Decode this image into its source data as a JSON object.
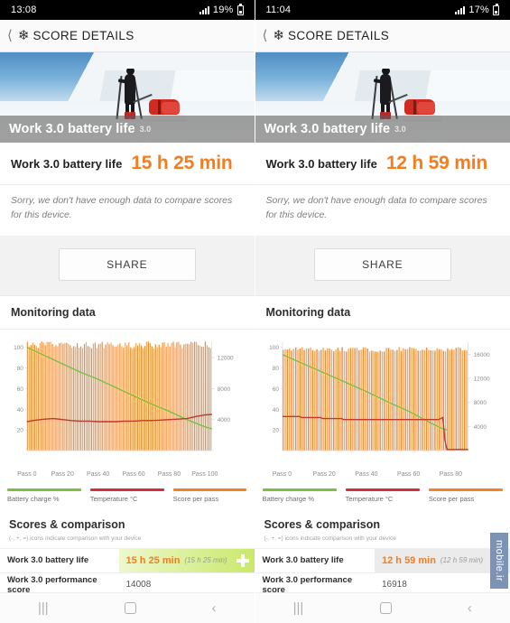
{
  "panels": [
    {
      "status": {
        "time": "13:08",
        "battery": "19%",
        "signal_icon": "signal-bars-icon",
        "battery_icon": "battery-icon"
      },
      "appbar": {
        "back_icon": "back-chevron-icon",
        "app_icon": "snowflake-icon",
        "title": "SCORE DETAILS"
      },
      "hero": {
        "caption": "Work 3.0 battery life",
        "badge": "3.0",
        "image": "skier-pulling-sled-in-snow"
      },
      "score": {
        "label": "Work 3.0 battery life",
        "value": "15 h 25 min"
      },
      "nodata": "Sorry, we don't have enough data to compare scores for this device.",
      "share_label": "SHARE",
      "monitoring_title": "Monitoring data",
      "legend": [
        {
          "label": "Battery charge %",
          "color": "#7ac143"
        },
        {
          "label": "Temperature °C",
          "color": "#d12f3b"
        },
        {
          "label": "Score per pass",
          "color": "#f58220"
        }
      ],
      "comparison": {
        "title": "Scores & comparison",
        "subtitle": "(-, +, =) icons indicate comparison with your device",
        "rows": [
          {
            "name": "Work 3.0 battery life",
            "value": "15 h 25 min",
            "reference": "(15 h 25 min)",
            "icon": "plus-icon",
            "highlight": "green"
          },
          {
            "name": "Work 3.0 performance score",
            "value": "14008",
            "reference": "",
            "icon": "",
            "highlight": "none"
          }
        ]
      },
      "chart_data": {
        "type": "line",
        "title": "Monitoring data",
        "xlabel": "",
        "ylabel": "Battery charge % / Temperature °C",
        "y2label": "Score per pass",
        "ylim": [
          0,
          105
        ],
        "y2lim": [
          0,
          14000
        ],
        "yticks": [
          20,
          40,
          60,
          80,
          100
        ],
        "y2ticks": [
          4000,
          8000,
          12000
        ],
        "xticks": [
          "Pass 0",
          "Pass 20",
          "Pass 40",
          "Pass 60",
          "Pass 80",
          "Pass 100"
        ],
        "xlim": [
          0,
          104
        ],
        "grid": false,
        "legend_position": "below",
        "series": [
          {
            "name": "Battery charge %",
            "color": "#7ac143",
            "type": "line",
            "x": [
              0,
              10,
              20,
              30,
              40,
              50,
              60,
              70,
              80,
              90,
              100,
              104
            ],
            "values": [
              100,
              92,
              84,
              76,
              69,
              61,
              53,
              45,
              38,
              30,
              23,
              21
            ]
          },
          {
            "name": "Temperature °C",
            "color": "#c0392b",
            "type": "line",
            "x": [
              0,
              5,
              10,
              15,
              20,
              25,
              30,
              35,
              40,
              45,
              50,
              55,
              60,
              65,
              70,
              75,
              80,
              85,
              90,
              95,
              100,
              104
            ],
            "values": [
              28,
              29.5,
              30.5,
              31,
              30,
              29,
              28.5,
              28.5,
              28,
              28,
              28,
              28.5,
              28.5,
              29,
              29,
              29.5,
              30,
              30.5,
              31,
              33,
              34.5,
              35
            ]
          },
          {
            "name": "Score per pass",
            "color": "#f58220",
            "type": "bar",
            "bar_count": 104,
            "value_range": [
              13200,
              14100
            ],
            "mean": 13700
          }
        ]
      }
    },
    {
      "status": {
        "time": "11:04",
        "battery": "17%",
        "signal_icon": "signal-bars-icon",
        "battery_icon": "battery-icon"
      },
      "appbar": {
        "back_icon": "back-chevron-icon",
        "app_icon": "snowflake-icon",
        "title": "SCORE DETAILS"
      },
      "hero": {
        "caption": "Work 3.0 battery life",
        "badge": "3.0",
        "image": "skier-pulling-sled-in-snow"
      },
      "score": {
        "label": "Work 3.0 battery life",
        "value": "12 h 59 min"
      },
      "nodata": "Sorry, we don't have enough data to compare scores for this device.",
      "share_label": "SHARE",
      "monitoring_title": "Monitoring data",
      "legend": [
        {
          "label": "Battery charge %",
          "color": "#7ac143"
        },
        {
          "label": "Temperature °C",
          "color": "#d12f3b"
        },
        {
          "label": "Score per pass",
          "color": "#f58220"
        }
      ],
      "comparison": {
        "title": "Scores & comparison",
        "subtitle": "(-, +, =) icons indicate comparison with your device",
        "rows": [
          {
            "name": "Work 3.0 battery life",
            "value": "12 h 59 min",
            "reference": "(12 h 59 min)",
            "icon": "equals-icon",
            "highlight": "gray"
          },
          {
            "name": "Work 3.0 performance score",
            "value": "16918",
            "reference": "",
            "icon": "",
            "highlight": "none"
          }
        ]
      },
      "chart_data": {
        "type": "line",
        "title": "Monitoring data",
        "xlabel": "",
        "ylabel": "Battery charge % / Temperature °C",
        "y2label": "Score per pass",
        "ylim": [
          0,
          105
        ],
        "y2lim": [
          0,
          18000
        ],
        "yticks": [
          20,
          40,
          60,
          80,
          100
        ],
        "y2ticks": [
          4000,
          8000,
          12000,
          16000
        ],
        "xticks": [
          "Pass 0",
          "Pass 20",
          "Pass 40",
          "Pass 60",
          "Pass 80"
        ],
        "xlim": [
          0,
          88
        ],
        "grid": false,
        "legend_position": "below",
        "series": [
          {
            "name": "Battery charge %",
            "color": "#7ac143",
            "type": "line",
            "x": [
              0,
              10,
              20,
              30,
              40,
              50,
              60,
              70,
              76,
              78
            ],
            "values": [
              93,
              84,
              75,
              66,
              57,
              47,
              38,
              27,
              21,
              20
            ]
          },
          {
            "name": "Temperature °C",
            "color": "#c0392b",
            "type": "line",
            "x": [
              0,
              8,
              9,
              18,
              19,
              28,
              29,
              40,
              55,
              68,
              74,
              76,
              77,
              78,
              88
            ],
            "values": [
              33,
              33,
              32,
              32,
              31,
              31,
              30,
              30,
              30,
              30,
              30,
              32,
              10,
              1,
              1
            ]
          },
          {
            "name": "Score per pass",
            "color": "#f58220",
            "type": "bar",
            "bar_count": 88,
            "value_range": [
              16400,
              17200
            ],
            "mean": 16900
          }
        ]
      }
    }
  ],
  "navbar": {
    "recents_icon": "recents-icon",
    "home_icon": "home-icon",
    "back_icon": "back-icon"
  },
  "watermark": "mobile.ir"
}
